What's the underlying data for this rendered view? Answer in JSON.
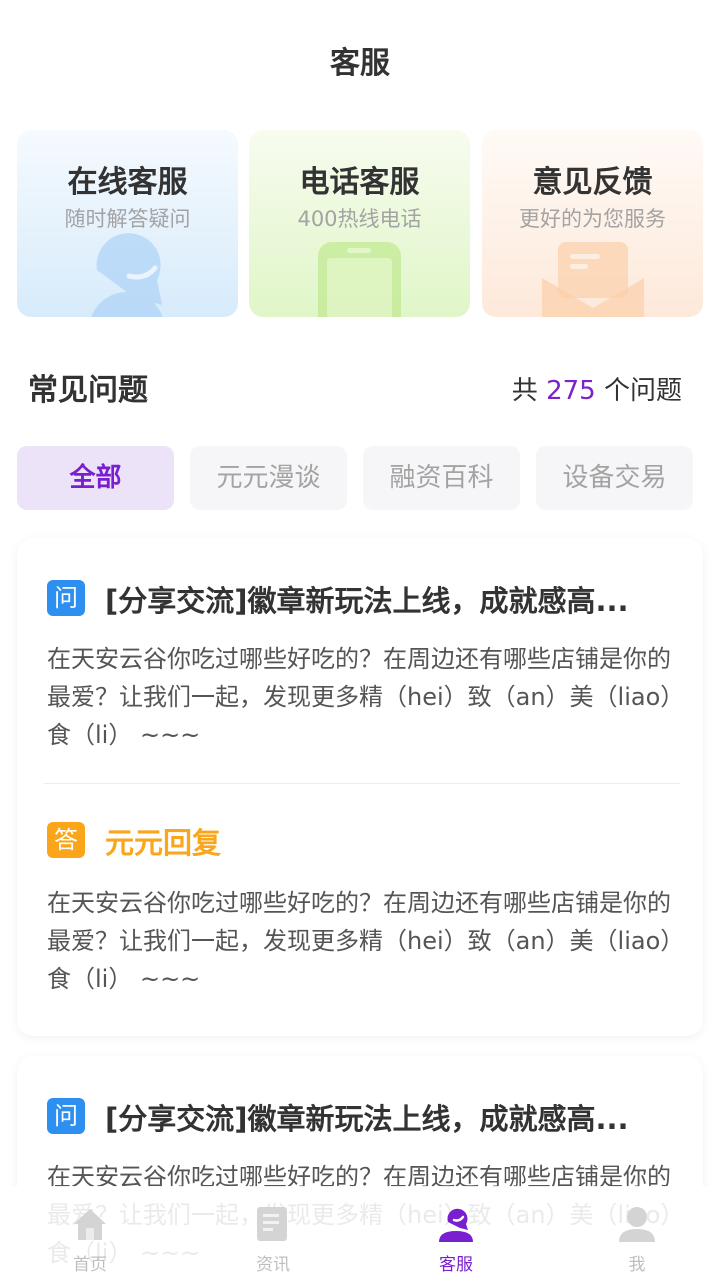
{
  "header": {
    "title": "客服"
  },
  "service_cards": [
    {
      "title": "在线客服",
      "subtitle": "随时解答疑问",
      "icon": "chat-bot-icon",
      "color": "#2d8ff0"
    },
    {
      "title": "电话客服",
      "subtitle": "400热线电话",
      "icon": "phone-icon",
      "color": "#8ad63f"
    },
    {
      "title": "意见反馈",
      "subtitle": "更好的为您服务",
      "icon": "envelope-icon",
      "color": "#f7a15c"
    }
  ],
  "faq": {
    "title": "常见问题",
    "count_prefix": "共",
    "count": "275",
    "count_suffix": "个问题",
    "tabs": [
      {
        "label": "全部",
        "active": true
      },
      {
        "label": "元元漫谈",
        "active": false
      },
      {
        "label": "融资百科",
        "active": false
      },
      {
        "label": "设备交易",
        "active": false
      }
    ],
    "items": [
      {
        "q_badge": "问",
        "question": "[分享交流]徽章新玩法上线，成就感高...",
        "question_detail": "在天安云谷你吃过哪些好吃的？在周边还有哪些店铺是你的最爱？让我们一起，发现更多精（hei）致（an）美（liao）食（li） ~~~",
        "a_badge": "答",
        "answer_label": "元元回复",
        "answer": "在天安云谷你吃过哪些好吃的？在周边还有哪些店铺是你的最爱？让我们一起，发现更多精（hei）致（an）美（liao）食（li） ~~~"
      },
      {
        "q_badge": "问",
        "question": "[分享交流]徽章新玩法上线，成就感高...",
        "question_detail": "在天安云谷你吃过哪些好吃的？在周边还有哪些店铺是你的最爱？让我们一起，发现更多精（hei）致（an）美（liao）食（li） ~~~"
      }
    ]
  },
  "tabbar": {
    "active_color": "#7a1fd0",
    "items": [
      {
        "label": "首页",
        "icon": "home-icon",
        "active": false
      },
      {
        "label": "资讯",
        "icon": "news-icon",
        "active": false
      },
      {
        "label": "客服",
        "icon": "customer-service-icon",
        "active": true
      },
      {
        "label": "我",
        "icon": "profile-icon",
        "active": false
      }
    ]
  }
}
